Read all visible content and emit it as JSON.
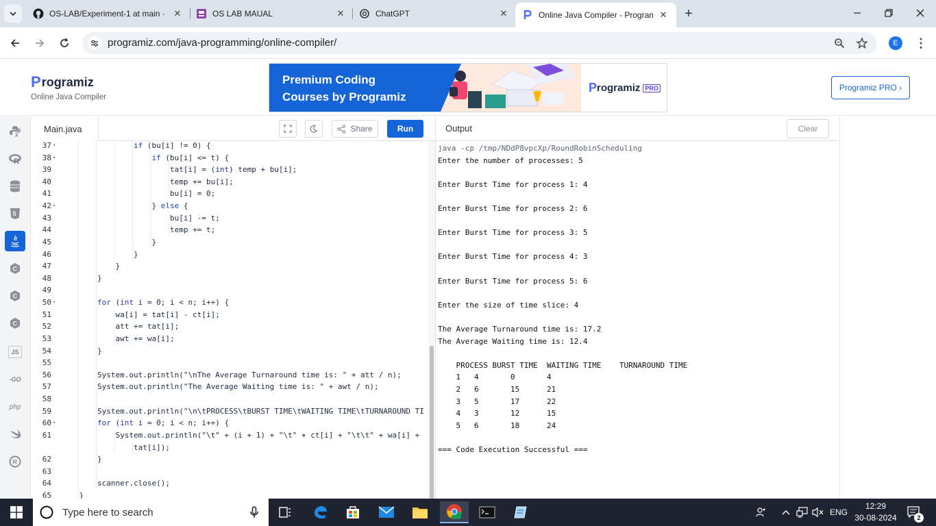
{
  "browser": {
    "tabs": [
      {
        "title": "OS-LAB/Experiment-1 at main ·",
        "icon": "github-icon"
      },
      {
        "title": "OS LAB MAUAL",
        "icon": "docs-icon"
      },
      {
        "title": "ChatGPT",
        "icon": "chatgpt-icon"
      },
      {
        "title": "Online Java Compiler - Program",
        "icon": "programiz-icon",
        "active": true
      }
    ],
    "url": "programiz.com/java-programming/online-compiler/",
    "profile_initial": "E"
  },
  "site": {
    "logo": "rogramiz",
    "logo_letter": "P",
    "subtitle": "Online Java Compiler",
    "banner_text": "Premium Coding Courses by Programiz",
    "banner_logo": "rogramiz",
    "banner_logo_letter": "P",
    "banner_pro_tag": "PRO",
    "pro_button": "Programiz PRO ›"
  },
  "rail": {
    "items": [
      "python-icon",
      "r-icon",
      "sql-icon",
      "html5-icon",
      "java-icon",
      "c-icon",
      "cpp-icon",
      "csharp-icon",
      "js-icon",
      "go-icon",
      "php-icon",
      "swift-icon",
      "rust-icon"
    ],
    "labels": {
      "js": "JS",
      "go": "-GO",
      "php": "php"
    }
  },
  "editor": {
    "filename": "Main.java",
    "share_label": "Share",
    "run_label": "Run",
    "lines": [
      {
        "n": "37",
        "fold": true,
        "indent": 2,
        "text": "if (bu[i] != 0) {"
      },
      {
        "n": "38",
        "fold": true,
        "indent": 3,
        "text": "if (bu[i] <= t) {"
      },
      {
        "n": "39",
        "fold": false,
        "indent": 4,
        "text": "tat[i] = (int) temp + bu[i];"
      },
      {
        "n": "40",
        "fold": false,
        "indent": 4,
        "text": "temp += bu[i];"
      },
      {
        "n": "41",
        "fold": false,
        "indent": 4,
        "text": "bu[i] = 0;"
      },
      {
        "n": "42",
        "fold": true,
        "indent": 3,
        "text": "} else {"
      },
      {
        "n": "43",
        "fold": false,
        "indent": 4,
        "text": "bu[i] -= t;"
      },
      {
        "n": "44",
        "fold": false,
        "indent": 4,
        "text": "temp += t;"
      },
      {
        "n": "45",
        "fold": false,
        "indent": 3,
        "text": "}"
      },
      {
        "n": "46",
        "fold": false,
        "indent": 2,
        "text": "}"
      },
      {
        "n": "47",
        "fold": false,
        "indent": 1,
        "text": "}"
      },
      {
        "n": "48",
        "fold": false,
        "indent": 0,
        "text": "}"
      },
      {
        "n": "49",
        "fold": false,
        "indent": 0,
        "text": ""
      },
      {
        "n": "50",
        "fold": true,
        "indent": 0,
        "text": "for (int i = 0; i < n; i++) {"
      },
      {
        "n": "51",
        "fold": false,
        "indent": 1,
        "text": "wa[i] = tat[i] - ct[i];"
      },
      {
        "n": "52",
        "fold": false,
        "indent": 1,
        "text": "att += tat[i];"
      },
      {
        "n": "53",
        "fold": false,
        "indent": 1,
        "text": "awt += wa[i];"
      },
      {
        "n": "54",
        "fold": false,
        "indent": 0,
        "text": "}"
      },
      {
        "n": "55",
        "fold": false,
        "indent": 0,
        "text": ""
      },
      {
        "n": "56",
        "fold": false,
        "indent": 0,
        "text": "System.out.println(\"\\nThe Average Turnaround time is: \" + att / n);"
      },
      {
        "n": "57",
        "fold": false,
        "indent": 0,
        "text": "System.out.println(\"The Average Waiting time is: \" + awt / n);"
      },
      {
        "n": "58",
        "fold": false,
        "indent": 0,
        "text": ""
      },
      {
        "n": "59",
        "fold": false,
        "indent": 0,
        "text": "System.out.println(\"\\n\\tPROCESS\\tBURST TIME\\tWAITING TIME\\tTURNAROUND TI"
      },
      {
        "n": "60",
        "fold": true,
        "indent": 0,
        "text": "for (int i = 0; i < n; i++) {"
      },
      {
        "n": "61",
        "fold": false,
        "indent": 1,
        "text": "System.out.println(\"\\t\" + (i + 1) + \"\\t\" + ct[i] + \"\\t\\t\" + wa[i] +"
      },
      {
        "n": "",
        "fold": false,
        "indent": 2,
        "text": "tat[i]);"
      },
      {
        "n": "62",
        "fold": false,
        "indent": 0,
        "text": "}"
      },
      {
        "n": "63",
        "fold": false,
        "indent": 0,
        "text": ""
      },
      {
        "n": "64",
        "fold": false,
        "indent": 0,
        "text": "scanner.close();"
      },
      {
        "n": "65",
        "fold": false,
        "indent": -1,
        "text": "}"
      }
    ]
  },
  "output": {
    "title": "Output",
    "clear_label": "Clear",
    "lines": [
      "java -cp /tmp/NDdP8vpcXp/RoundRobinScheduling",
      "Enter the number of processes: 5",
      "",
      "Enter Burst Time for process 1: 4",
      "",
      "Enter Burst Time for process 2: 6",
      "",
      "Enter Burst Time for process 3: 5",
      "",
      "Enter Burst Time for process 4: 3",
      "",
      "Enter Burst Time for process 5: 6",
      "",
      "Enter the size of time slice: 4",
      "",
      "The Average Turnaround time is: 17.2",
      "The Average Waiting time is: 12.4",
      "",
      "    PROCESS BURST TIME  WAITING TIME    TURNAROUND TIME",
      "    1   4       0       4",
      "    2   6       15      21",
      "    3   5       17      22",
      "    4   3       12      15",
      "    5   6       18      24",
      "",
      "=== Code Execution Successful ==="
    ]
  },
  "taskbar": {
    "search_placeholder": "Type here to search",
    "language": "ENG",
    "time": "12:29",
    "date": "30-08-2024",
    "notification_count": "2"
  }
}
